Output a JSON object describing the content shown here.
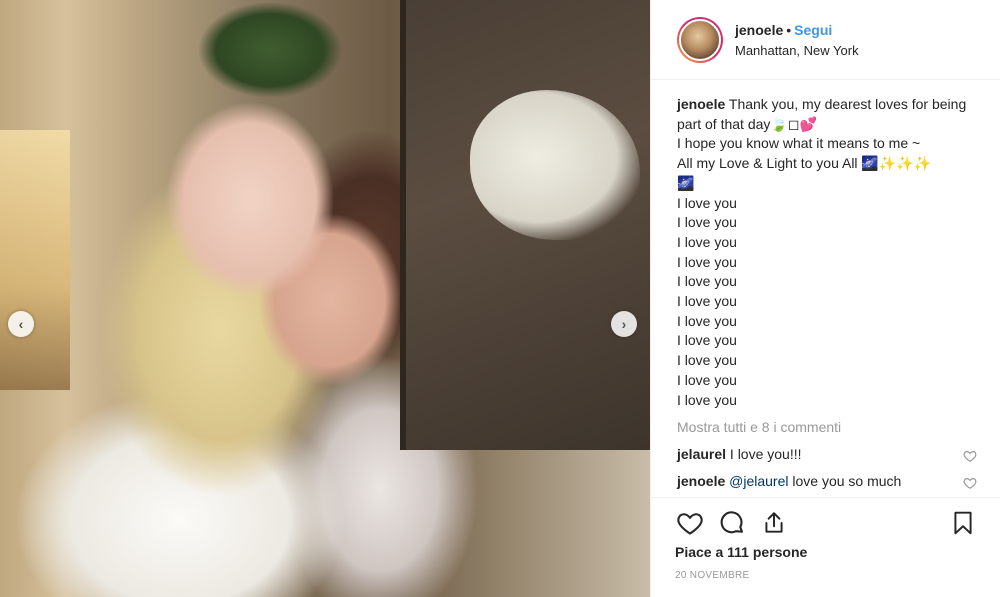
{
  "post": {
    "username": "jenoele",
    "dot": "•",
    "follow_label": "Segui",
    "location": "Manhattan, New York"
  },
  "caption": {
    "username": "jenoele",
    "text": " Thank you, my dearest loves for being part of that day🍃◻💕\nI hope you know what it means to me ~\nAll my Love & Light to you All 🌌✨✨✨\n🌌\nI love you\nI love you\nI love you\nI love you\nI love you\nI love you\nI love you\nI love you\nI love you\nI love you\nI love you"
  },
  "view_all_comments": "Mostra tutti e 8 i commenti",
  "comments": [
    {
      "username": "jelaurel",
      "text": " I love you!!!"
    },
    {
      "username": "jenoele",
      "mention": "@jelaurel",
      "text": " love you so much"
    }
  ],
  "likes_text": "Piace a 111 persone",
  "date": "20 NOVEMBRE",
  "icons": {
    "prev": "chevron-left-icon",
    "next": "chevron-right-icon",
    "like": "heart-icon",
    "comment": "comment-icon",
    "share": "share-icon",
    "save": "bookmark-icon"
  }
}
